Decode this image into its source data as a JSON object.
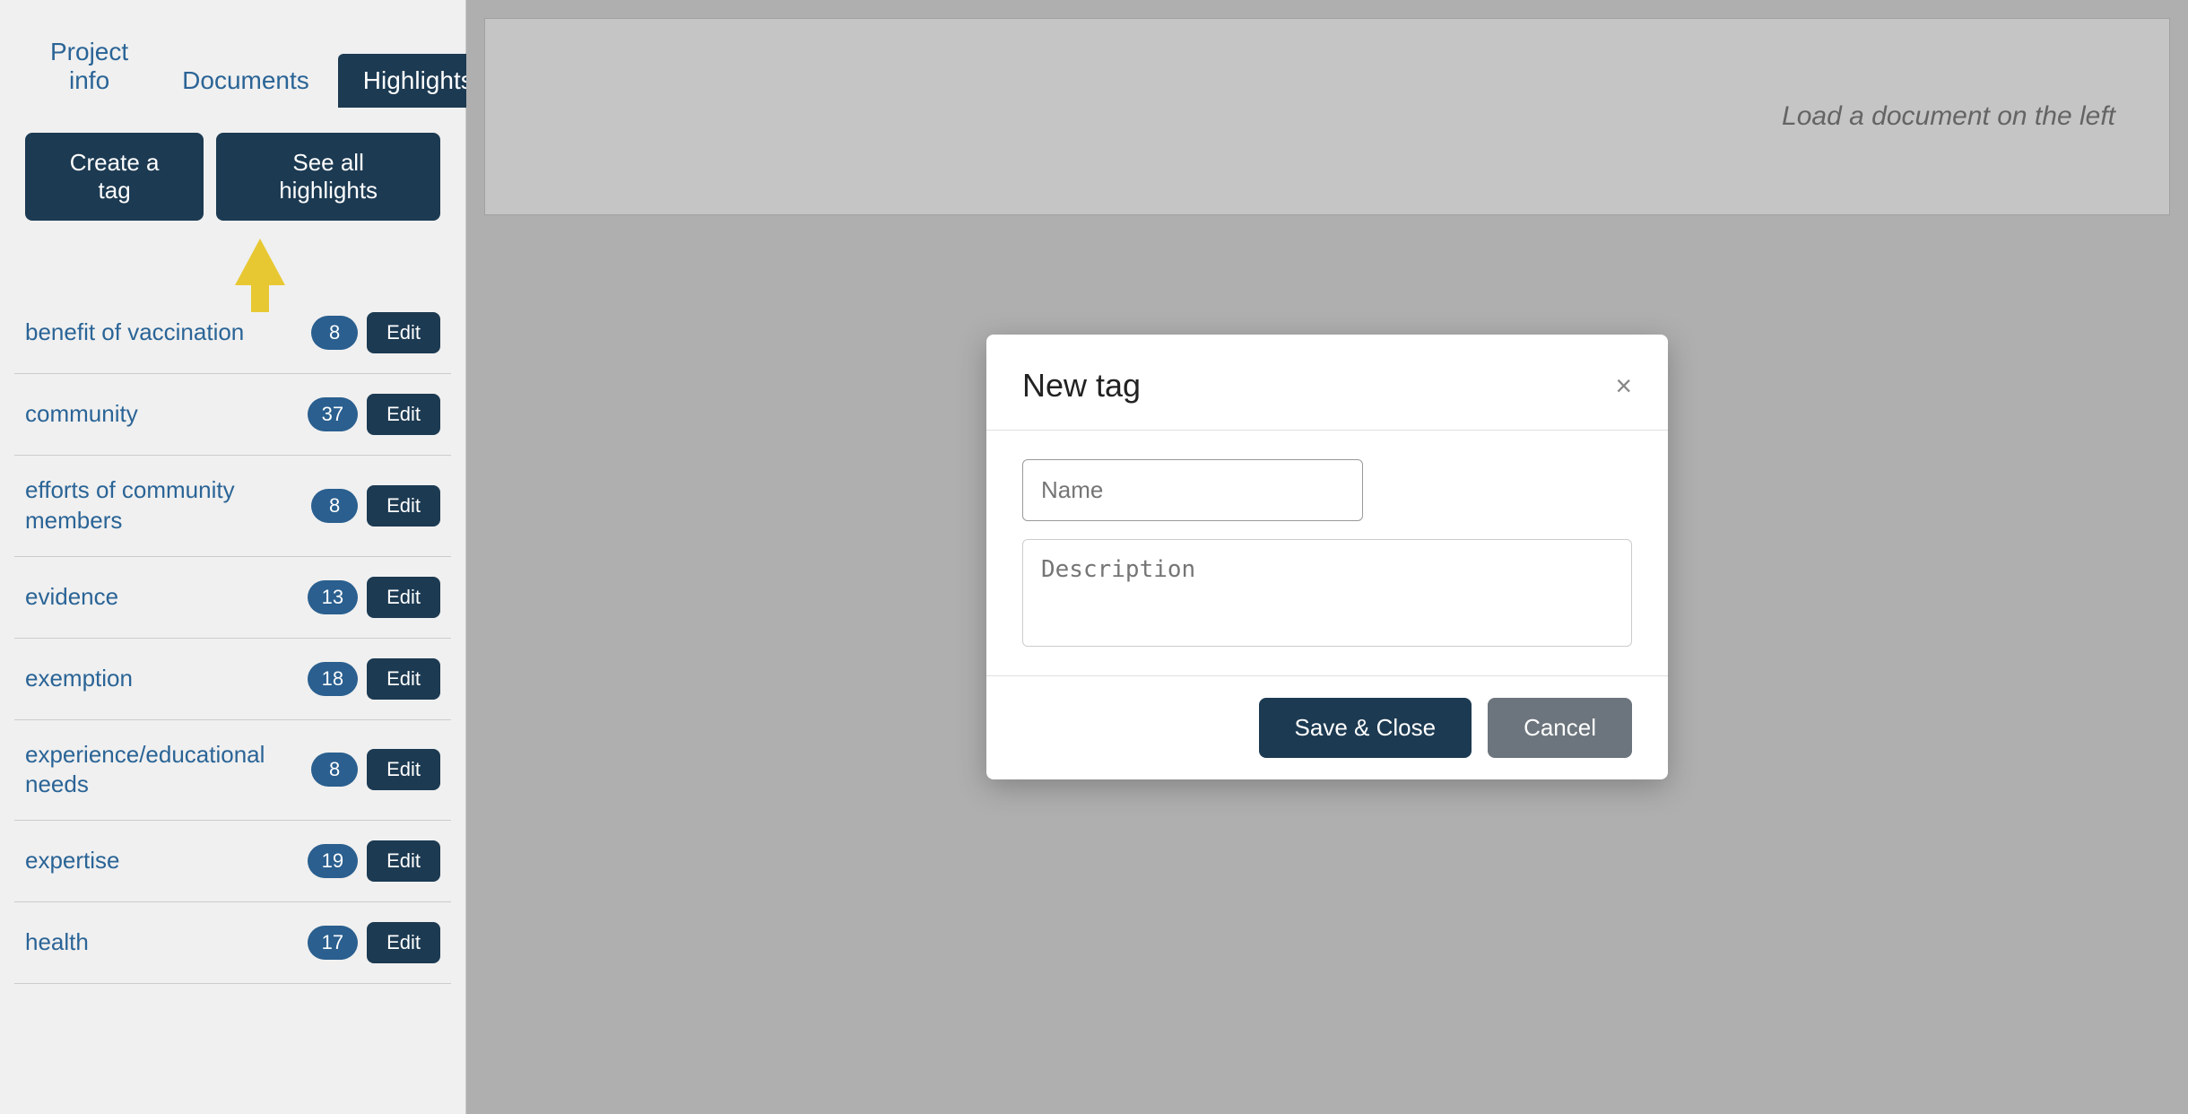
{
  "tabs": [
    {
      "label": "Project info",
      "active": false
    },
    {
      "label": "Documents",
      "active": false
    },
    {
      "label": "Highlights",
      "active": true
    }
  ],
  "buttons": {
    "create_tag": "Create a tag",
    "see_all": "See all highlights"
  },
  "tags": [
    {
      "name": "benefit of vaccination",
      "count": 8
    },
    {
      "name": "community",
      "count": 37
    },
    {
      "name": "efforts of community members",
      "count": 8
    },
    {
      "name": "evidence",
      "count": 13
    },
    {
      "name": "exemption",
      "count": 18
    },
    {
      "name": "experience/educational needs",
      "count": 8
    },
    {
      "name": "expertise",
      "count": 19
    },
    {
      "name": "health",
      "count": 17
    }
  ],
  "edit_label": "Edit",
  "doc_viewer": {
    "placeholder": "Load a document on the left"
  },
  "modal": {
    "title": "New tag",
    "name_placeholder": "Name",
    "description_placeholder": "Description",
    "save_label": "Save & Close",
    "cancel_label": "Cancel",
    "close_icon": "×"
  }
}
